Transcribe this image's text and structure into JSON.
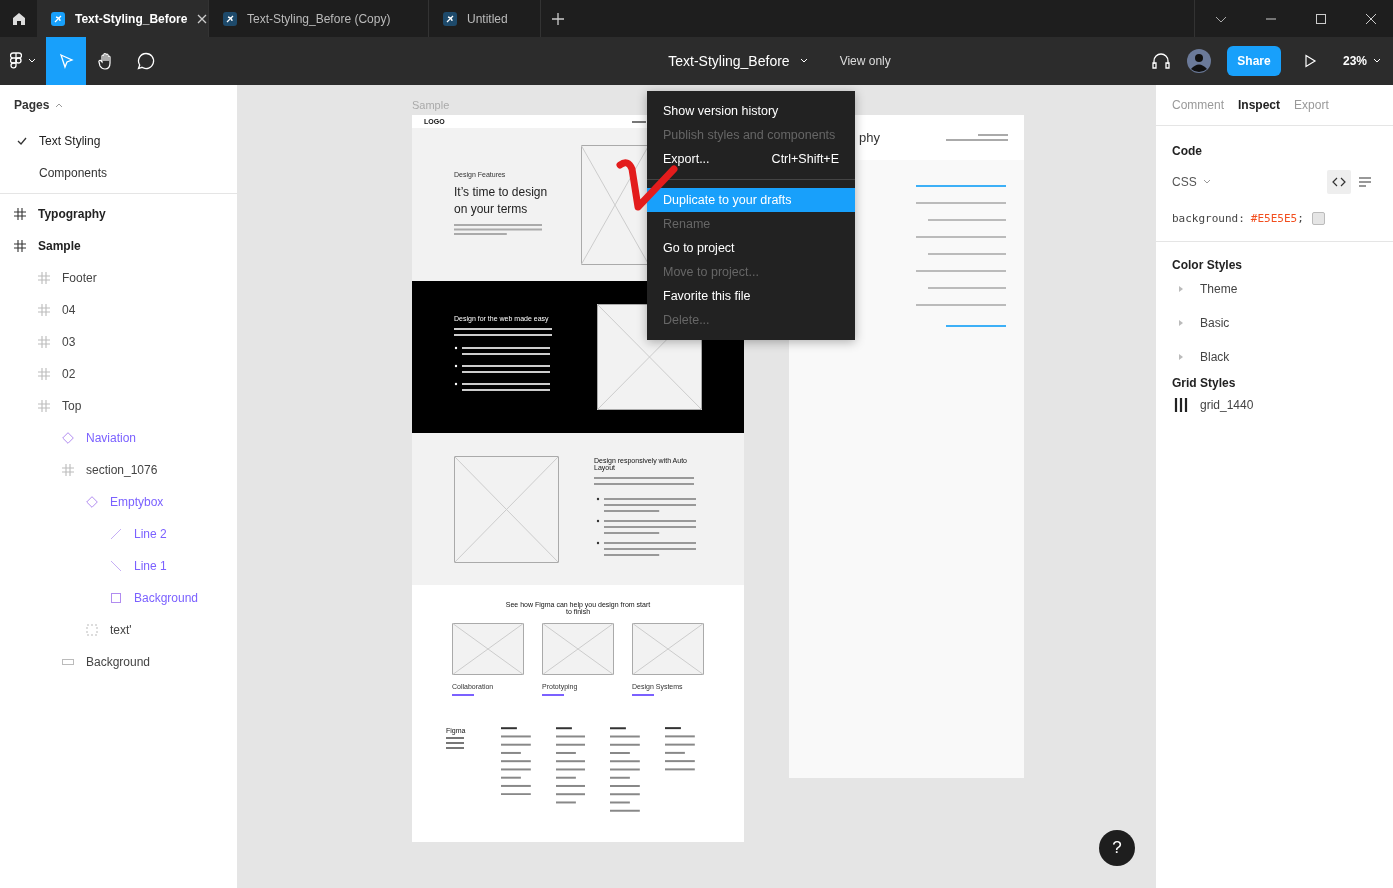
{
  "tabs": [
    {
      "label": "Text-Styling_Before",
      "selected": true
    },
    {
      "label": "Text-Styling_Before (Copy)",
      "selected": false
    },
    {
      "label": "Untitled",
      "selected": false
    }
  ],
  "toolbar": {
    "tools": [
      {
        "kind": "move",
        "selected": true
      },
      {
        "kind": "hand",
        "selected": false
      },
      {
        "kind": "comment",
        "selected": false
      }
    ],
    "file_title": "Text-Styling_Before",
    "view_mode": "View only",
    "share": "Share",
    "zoom": "23%"
  },
  "pages": {
    "title": "Pages",
    "items": [
      {
        "label": "Text Styling",
        "selected": true
      },
      {
        "label": "Components",
        "selected": false
      }
    ]
  },
  "layers": [
    {
      "label": "Typography",
      "kind": "frame",
      "instance": false
    },
    {
      "label": "Sample",
      "kind": "frame",
      "instance": false,
      "children": [
        {
          "label": "Footer",
          "kind": "frame",
          "instance": false
        },
        {
          "label": "04",
          "kind": "frame",
          "instance": false
        },
        {
          "label": "03",
          "kind": "frame",
          "instance": false
        },
        {
          "label": "02",
          "kind": "frame",
          "instance": false
        },
        {
          "label": "Top",
          "kind": "frame",
          "instance": false,
          "children": [
            {
              "label": "Naviation",
              "kind": "component",
              "instance": true
            },
            {
              "label": "section_1076",
              "kind": "frame",
              "instance": false,
              "children": [
                {
                  "label": "Emptybox",
                  "kind": "component",
                  "instance": true,
                  "children": [
                    {
                      "label": "Line 2",
                      "kind": "line",
                      "instance": true
                    },
                    {
                      "label": "Line 1",
                      "kind": "line",
                      "instance": true
                    },
                    {
                      "label": "Background",
                      "kind": "rect",
                      "instance": true
                    }
                  ]
                },
                {
                  "label": "text'",
                  "kind": "group",
                  "instance": false
                }
              ]
            },
            {
              "label": "Background",
              "kind": "rect",
              "instance": false
            }
          ]
        }
      ]
    }
  ],
  "canvas": {
    "sample": {
      "name": "Sample",
      "logo": "LOGO",
      "hero": {
        "eyebrow": "Design Features",
        "heading": "It’s time to design on your terms"
      },
      "web": {
        "heading": "Design for the web made easy"
      },
      "auto": {
        "heading": "Design responsively with Auto Layout"
      },
      "cards": {
        "heading": "See how Figma can help you design from start to finish",
        "items": [
          {
            "label": "Collaboration"
          },
          {
            "label": "Prototyping"
          },
          {
            "label": "Design Systems"
          }
        ]
      },
      "footer": {
        "brand": "Figma"
      }
    },
    "typography": {
      "title": "phy"
    }
  },
  "menu": [
    {
      "kind": "item",
      "label": "Show version history",
      "disabled": false,
      "selected": false
    },
    {
      "kind": "item",
      "label": "Publish styles and components",
      "disabled": true,
      "selected": false
    },
    {
      "kind": "item",
      "label": "Export...",
      "shortcut": "Ctrl+Shift+E",
      "disabled": false,
      "selected": false
    },
    {
      "kind": "separator"
    },
    {
      "kind": "item",
      "label": "Duplicate to your drafts",
      "disabled": false,
      "selected": true
    },
    {
      "kind": "item",
      "label": "Rename",
      "disabled": true,
      "selected": false
    },
    {
      "kind": "item",
      "label": "Go to project",
      "disabled": false,
      "selected": false
    },
    {
      "kind": "item",
      "label": "Move to project...",
      "disabled": true,
      "selected": false
    },
    {
      "kind": "item",
      "label": "Favorite this file",
      "disabled": false,
      "selected": false
    },
    {
      "kind": "item",
      "label": "Delete...",
      "disabled": true,
      "selected": false
    }
  ],
  "inspect": {
    "tabs": [
      {
        "label": "Comment",
        "selected": false
      },
      {
        "label": "Inspect",
        "selected": true
      },
      {
        "label": "Export",
        "selected": false
      }
    ],
    "code": {
      "title": "Code",
      "language": "CSS",
      "views": [
        {
          "kind": "code",
          "selected": true
        },
        {
          "kind": "list",
          "selected": false
        }
      ],
      "property": "background:",
      "value": "#E5E5E5",
      "suffix": ";",
      "color": "#e5e5e5"
    },
    "color_styles": {
      "title": "Color Styles",
      "items": [
        {
          "label": "Theme",
          "expanded": false
        },
        {
          "label": "Basic",
          "expanded": false
        },
        {
          "label": "Black",
          "expanded": false
        }
      ]
    },
    "grid_styles": {
      "title": "Grid Styles",
      "items": [
        {
          "label": "grid_1440"
        }
      ]
    }
  },
  "help": "?"
}
